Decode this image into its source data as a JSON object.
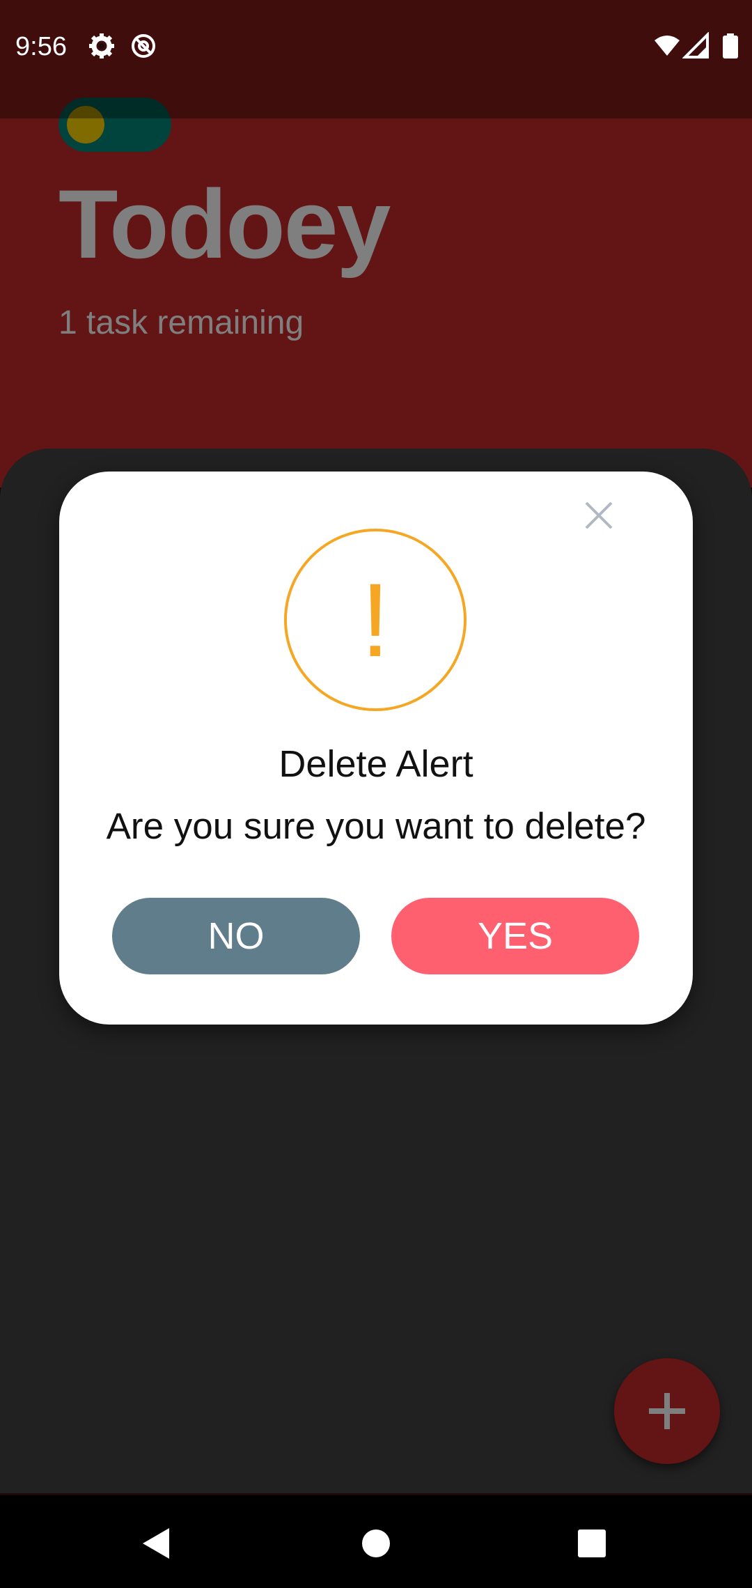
{
  "status_bar": {
    "time": "9:56",
    "left_icons": [
      "gear-icon",
      "no-sync-icon"
    ],
    "right_icons": [
      "wifi-icon",
      "cell-signal-icon",
      "battery-icon"
    ]
  },
  "app": {
    "title": "Todoey",
    "subtitle": "1 task remaining",
    "accent_color": "#c62828",
    "panel_color": "#424242",
    "theme_toggle_on": true,
    "fab_icon": "plus-icon"
  },
  "dialog": {
    "title": "Delete Alert",
    "message": "Are you sure you want to delete?",
    "icon": "exclamation-icon",
    "icon_color": "#f5a623",
    "close_icon": "close-icon",
    "no_label": "NO",
    "yes_label": "YES",
    "no_color": "#607d8b",
    "yes_color": "#ff6070",
    "exclamation_glyph": "!"
  },
  "nav_bar": {
    "buttons": [
      "back-icon",
      "home-icon",
      "recents-icon"
    ]
  }
}
